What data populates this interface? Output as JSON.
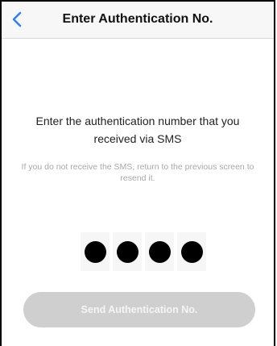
{
  "nav": {
    "back_icon": "chevron-left-icon",
    "title": "Enter Authentication No."
  },
  "main": {
    "instruction": "Enter the authentication number that you received via SMS",
    "hint": "If you do not receive the SMS, return to the previous screen to resend it.",
    "pin_length": 4,
    "entered_digits": 4
  },
  "send_button": {
    "label": "Send Authentication No.",
    "enabled": false
  },
  "colors": {
    "accent": "#2f7cf6",
    "button_disabled": "#cfcfcf",
    "hint_text": "#a8a8a8"
  }
}
